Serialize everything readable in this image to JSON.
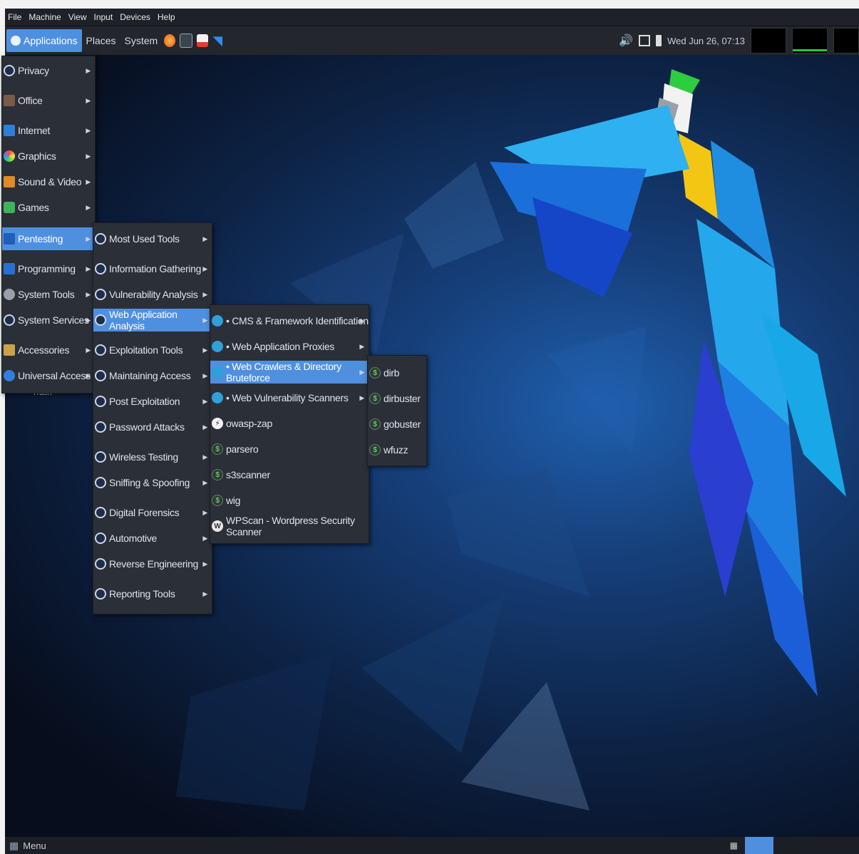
{
  "vm_menubar": [
    "File",
    "Machine",
    "View",
    "Input",
    "Devices",
    "Help"
  ],
  "panel": {
    "applications": "Applications",
    "places": "Places",
    "system": "System",
    "clock": "Wed Jun 26, 07:13"
  },
  "menu_main": [
    {
      "label": "Privacy"
    },
    {
      "label": "Office"
    },
    {
      "label": "Internet"
    },
    {
      "label": "Graphics"
    },
    {
      "label": "Sound & Video"
    },
    {
      "label": "Games"
    },
    {
      "label": "Pentesting"
    },
    {
      "label": "Programming"
    },
    {
      "label": "System Tools"
    },
    {
      "label": "System Services"
    },
    {
      "label": "Accessories"
    },
    {
      "label": "Universal Access"
    }
  ],
  "menu_pentest": [
    {
      "label": "Most Used Tools"
    },
    {
      "label": "Information Gathering"
    },
    {
      "label": "Vulnerability Analysis"
    },
    {
      "label": "Web Application Analysis"
    },
    {
      "label": "Exploitation Tools"
    },
    {
      "label": "Maintaining Access"
    },
    {
      "label": "Post Exploitation"
    },
    {
      "label": "Password Attacks"
    },
    {
      "label": "Wireless Testing"
    },
    {
      "label": "Sniffing & Spoofing"
    },
    {
      "label": "Digital Forensics"
    },
    {
      "label": "Automotive"
    },
    {
      "label": "Reverse Engineering"
    },
    {
      "label": "Reporting Tools"
    }
  ],
  "menu_webapp": [
    {
      "label": "• CMS & Framework Identification"
    },
    {
      "label": "• Web Application Proxies"
    },
    {
      "label": "• Web Crawlers & Directory Bruteforce"
    },
    {
      "label": "• Web Vulnerability Scanners"
    },
    {
      "label": "owasp-zap"
    },
    {
      "label": "parsero"
    },
    {
      "label": "s3scanner"
    },
    {
      "label": "wig"
    },
    {
      "label": "WPScan - Wordpress Security Scanner"
    }
  ],
  "menu_crawlers": [
    {
      "label": "dirb"
    },
    {
      "label": "dirbuster"
    },
    {
      "label": "gobuster"
    },
    {
      "label": "wfuzz"
    }
  ],
  "desktop_trash": "Trash",
  "bottom": {
    "menu_label": "Menu"
  },
  "colors": {
    "selection": "#4f8fe0",
    "menu_bg": "#2b2f38",
    "panel_bg": "#23262d"
  }
}
